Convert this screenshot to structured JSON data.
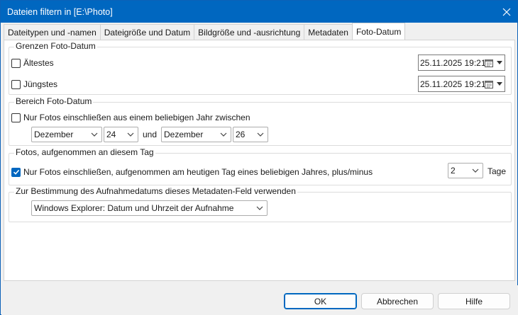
{
  "window": {
    "title": "Dateien filtern in [E:\\Photo]"
  },
  "tabs": [
    {
      "label": "Dateitypen und -namen"
    },
    {
      "label": "Dateigröße und Datum"
    },
    {
      "label": "Bildgröße und -ausrichtung"
    },
    {
      "label": "Metadaten"
    },
    {
      "label": "Foto-Datum",
      "active": true
    }
  ],
  "limits": {
    "legend": "Grenzen Foto-Datum",
    "oldest": {
      "label": "Ältestes",
      "checked": false,
      "value": "25.11.2025 19:21"
    },
    "newest": {
      "label": "Jüngstes",
      "checked": false,
      "value": "25.11.2025 19:21"
    }
  },
  "range": {
    "legend": "Bereich Foto-Datum",
    "checkbox_label": "Nur Fotos einschließen aus einem beliebigen Jahr zwischen",
    "checked": false,
    "from_month": "Dezember",
    "from_day": "24",
    "and_label": "und",
    "to_month": "Dezember",
    "to_day": "26"
  },
  "day": {
    "legend": "Fotos, aufgenommen an diesem Tag",
    "checkbox_label": "Nur Fotos einschließen, aufgenommen am heutigen Tag eines beliebigen Jahres, plus/minus",
    "checked": true,
    "days_value": "2",
    "days_label": "Tage"
  },
  "metadata": {
    "legend": "Zur Bestimmung des Aufnahmedatums dieses Metadaten-Feld verwenden",
    "field": "Windows Explorer: Datum und Uhrzeit der Aufnahme"
  },
  "buttons": {
    "ok": "OK",
    "cancel": "Abbrechen",
    "help": "Hilfe"
  },
  "colors": {
    "titlebar": "#0067c0",
    "accent": "#0067c0"
  },
  "icons": [
    "close-icon",
    "calendar-icon",
    "chevron-down-icon",
    "checkmark-icon"
  ]
}
